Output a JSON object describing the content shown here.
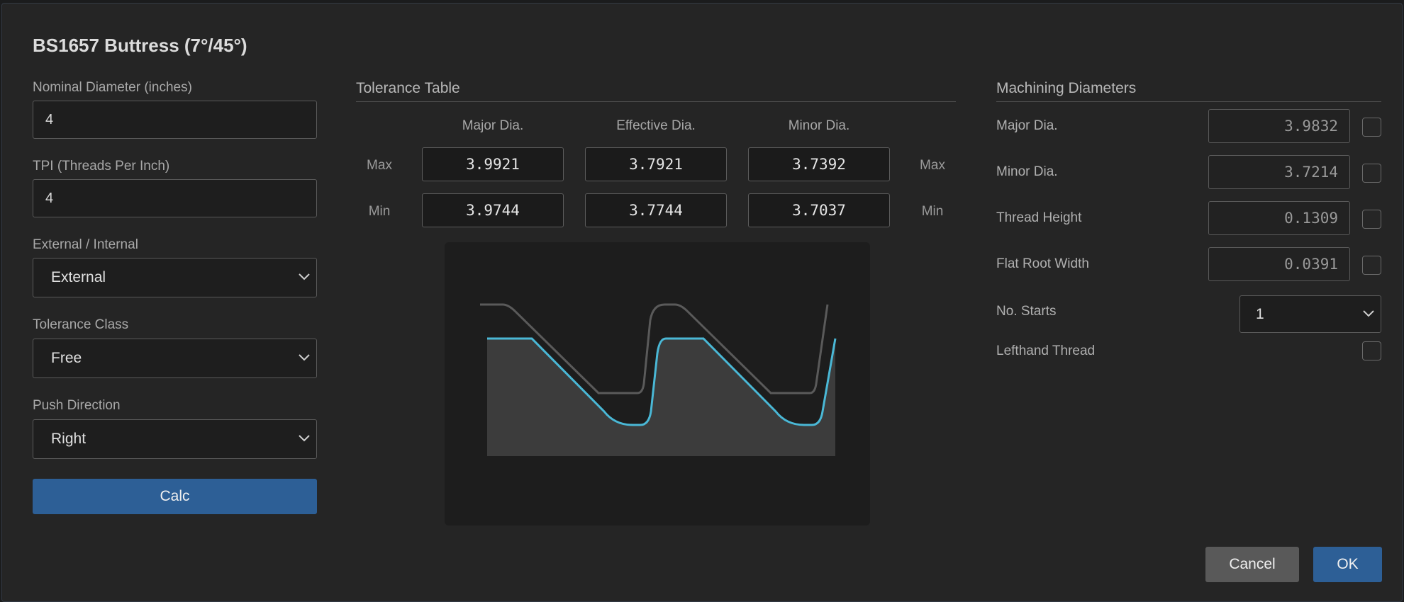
{
  "dialog": {
    "title": "BS1657 Buttress (7°/45°)"
  },
  "inputs": {
    "nominal_diameter": {
      "label": "Nominal Diameter (inches)",
      "value": "4"
    },
    "tpi": {
      "label": "TPI (Threads Per Inch)",
      "value": "4"
    },
    "external_internal": {
      "label": "External / Internal",
      "value": "External"
    },
    "tolerance_class": {
      "label": "Tolerance Class",
      "value": "Free"
    },
    "push_direction": {
      "label": "Push Direction",
      "value": "Right"
    },
    "calc_label": "Calc"
  },
  "tolerance_table": {
    "title": "Tolerance Table",
    "columns": [
      "Major Dia.",
      "Effective Dia.",
      "Minor Dia."
    ],
    "row_labels": {
      "max": "Max",
      "min": "Min"
    },
    "max": [
      "3.9921",
      "3.7921",
      "3.7392"
    ],
    "min": [
      "3.9744",
      "3.7744",
      "3.7037"
    ]
  },
  "machining": {
    "title": "Machining Diameters",
    "rows": [
      {
        "label": "Major Dia.",
        "value": "3.9832",
        "checked": false
      },
      {
        "label": "Minor Dia.",
        "value": "3.7214",
        "checked": false
      },
      {
        "label": "Thread Height",
        "value": "0.1309",
        "checked": false
      },
      {
        "label": "Flat Root Width",
        "value": "0.0391",
        "checked": false
      }
    ],
    "starts": {
      "label": "No. Starts",
      "value": "1"
    },
    "lefthand": {
      "label": "Lefthand Thread",
      "checked": false
    }
  },
  "footer": {
    "cancel_label": "Cancel",
    "ok_label": "OK"
  },
  "colors": {
    "accent": "#2d5f96",
    "profile_cyan": "#4ab8d6",
    "profile_outline": "#5a5a5a",
    "fill_gray": "#3c3c3c"
  },
  "icons": {
    "select_arrow": "chevron-down-icon",
    "thread_profile": "thread-profile-diagram"
  }
}
